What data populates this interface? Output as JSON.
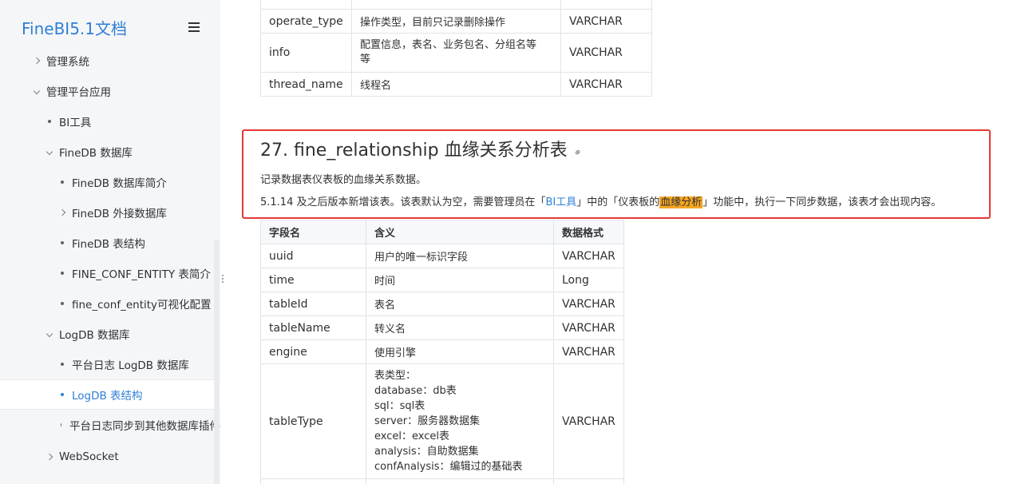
{
  "sidebar": {
    "brand": "FineBI5.1文档",
    "items": [
      {
        "label": "管理系统",
        "type": "collapsed"
      },
      {
        "label": "管理平台应用",
        "type": "expanded"
      },
      {
        "label": "BI工具",
        "type": "leaf"
      },
      {
        "label": "FineDB 数据库",
        "type": "expanded"
      },
      {
        "label": "FineDB 数据库简介",
        "type": "leaf"
      },
      {
        "label": "FineDB 外接数据库",
        "type": "collapsed"
      },
      {
        "label": "FineDB 表结构",
        "type": "leaf"
      },
      {
        "label": "FINE_CONF_ENTITY 表简介",
        "type": "leaf"
      },
      {
        "label": "fine_conf_entity可视化配置",
        "type": "leaf"
      },
      {
        "label": "LogDB 数据库",
        "type": "expanded"
      },
      {
        "label": "平台日志 LogDB 数据库",
        "type": "leaf"
      },
      {
        "label": "LogDB 表结构",
        "type": "leaf",
        "active": true
      },
      {
        "label": "平台日志同步到其他数据库插件",
        "type": "leaf"
      },
      {
        "label": "WebSocket",
        "type": "collapsed"
      }
    ]
  },
  "prev_table": {
    "rows": [
      {
        "field": "operate_type",
        "desc": "操作类型，目前只记录删除操作",
        "format": "VARCHAR"
      },
      {
        "field": "info",
        "desc_line1": "配置信息，表名、业务包名、分组名等",
        "desc_line2": "等",
        "format": "VARCHAR"
      },
      {
        "field": "thread_name",
        "desc": "线程名",
        "format": "VARCHAR"
      }
    ]
  },
  "section": {
    "title": "27. fine_relationship 血缘关系分析表",
    "para1": "记录数据表仪表板的血缘关系数据。",
    "para2_a": "5.1.14 及之后版本新增该表。该表默认为空，需要管理员在「",
    "para2_link": "BI工具",
    "para2_b": "」中的「仪表板的",
    "para2_mark": "血缘分析",
    "para2_c": "」功能中，执行一下同步数据，该表才会出现内容。"
  },
  "table": {
    "headers": {
      "field": "字段名",
      "desc": "含义",
      "format": "数据格式"
    },
    "rows": [
      {
        "field": "uuid",
        "desc": "用户的唯一标识字段",
        "format": "VARCHAR"
      },
      {
        "field": "time",
        "desc": "时间",
        "format": "Long"
      },
      {
        "field": "tableId",
        "desc": "表名",
        "format": "VARCHAR"
      },
      {
        "field": "tableName",
        "desc": "转义名",
        "format": "VARCHAR"
      },
      {
        "field": "engine",
        "desc": "使用引擎",
        "format": "VARCHAR"
      }
    ],
    "table_type": {
      "field": "tableType",
      "format": "VARCHAR",
      "lines": [
        "表类型：",
        "database：db表",
        "sql：sql表",
        "server：服务器数据集",
        "excel：excel表",
        "analysis：自助数据集",
        "confAnalysis：编辑过的基础表"
      ]
    }
  }
}
